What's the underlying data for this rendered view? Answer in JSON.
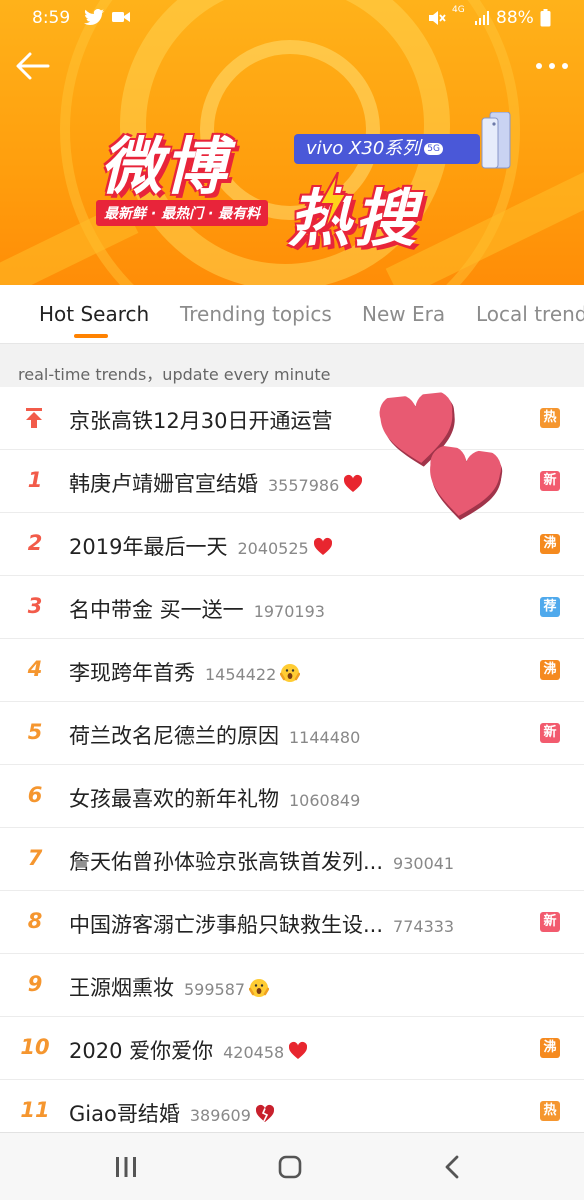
{
  "status_bar": {
    "time": "8:59",
    "network": "4G",
    "battery": "88%"
  },
  "banner": {
    "title_part1": "微博",
    "title_part2": "热搜",
    "slogan": "最新鲜 · 最热门 · 最有料",
    "sponsor": "vivo X30系列",
    "sponsor_badge": "5G",
    "colors": {
      "background": "#ffa313",
      "accent_red": "#e8243a",
      "sponsor_blue": "#4a58d8"
    }
  },
  "tabs": [
    {
      "label": "Hot Search",
      "active": true
    },
    {
      "label": "Trending topics",
      "active": false
    },
    {
      "label": "New Era",
      "active": false
    },
    {
      "label": "Local trends",
      "active": false
    }
  ],
  "notice": "real-time trends，update every minute",
  "list": {
    "items": [
      {
        "rank": "",
        "pinned": true,
        "title": "京张高铁12月30日开通运营",
        "count": "",
        "emoji": "",
        "badge": "热",
        "badge_color": "#f5962f"
      },
      {
        "rank": "1",
        "title": "韩庚卢靖姗官宣结婚",
        "count": "3557986",
        "emoji": "heart-icon",
        "badge": "新",
        "badge_color": "#f25b6e"
      },
      {
        "rank": "2",
        "title": "2019年最后一天",
        "count": "2040525",
        "emoji": "heart-icon",
        "badge": "沸",
        "badge_color": "#f58a1f"
      },
      {
        "rank": "3",
        "title": "名中带金 买一送一",
        "count": "1970193",
        "emoji": "",
        "badge": "荐",
        "badge_color": "#4fa9ec"
      },
      {
        "rank": "4",
        "title": "李现跨年首秀",
        "count": "1454422",
        "emoji": "scream-face-icon",
        "badge": "沸",
        "badge_color": "#f58a1f"
      },
      {
        "rank": "5",
        "title": "荷兰改名尼德兰的原因",
        "count": "1144480",
        "emoji": "",
        "badge": "新",
        "badge_color": "#f25b6e"
      },
      {
        "rank": "6",
        "title": "女孩最喜欢的新年礼物",
        "count": "1060849",
        "emoji": "",
        "badge": "",
        "badge_color": ""
      },
      {
        "rank": "7",
        "title": "詹天佑曾孙体验京张高铁首发列...",
        "count": "930041",
        "emoji": "",
        "badge": "",
        "badge_color": ""
      },
      {
        "rank": "8",
        "title": "中国游客溺亡涉事船只缺救生设...",
        "count": "774333",
        "emoji": "",
        "badge": "新",
        "badge_color": "#f25b6e"
      },
      {
        "rank": "9",
        "title": "王源烟熏妆",
        "count": "599587",
        "emoji": "scream-face-icon",
        "badge": "",
        "badge_color": ""
      },
      {
        "rank": "10",
        "title": "2020 爱你爱你",
        "count": "420458",
        "emoji": "heart-icon",
        "badge": "沸",
        "badge_color": "#f58a1f"
      },
      {
        "rank": "11",
        "title": "Giao哥结婚",
        "count": "389609",
        "emoji": "broken-heart-icon",
        "badge": "热",
        "badge_color": "#f5962f"
      }
    ]
  },
  "navbar": {
    "icons": [
      "recent-apps-icon",
      "home-icon",
      "back-icon"
    ]
  }
}
